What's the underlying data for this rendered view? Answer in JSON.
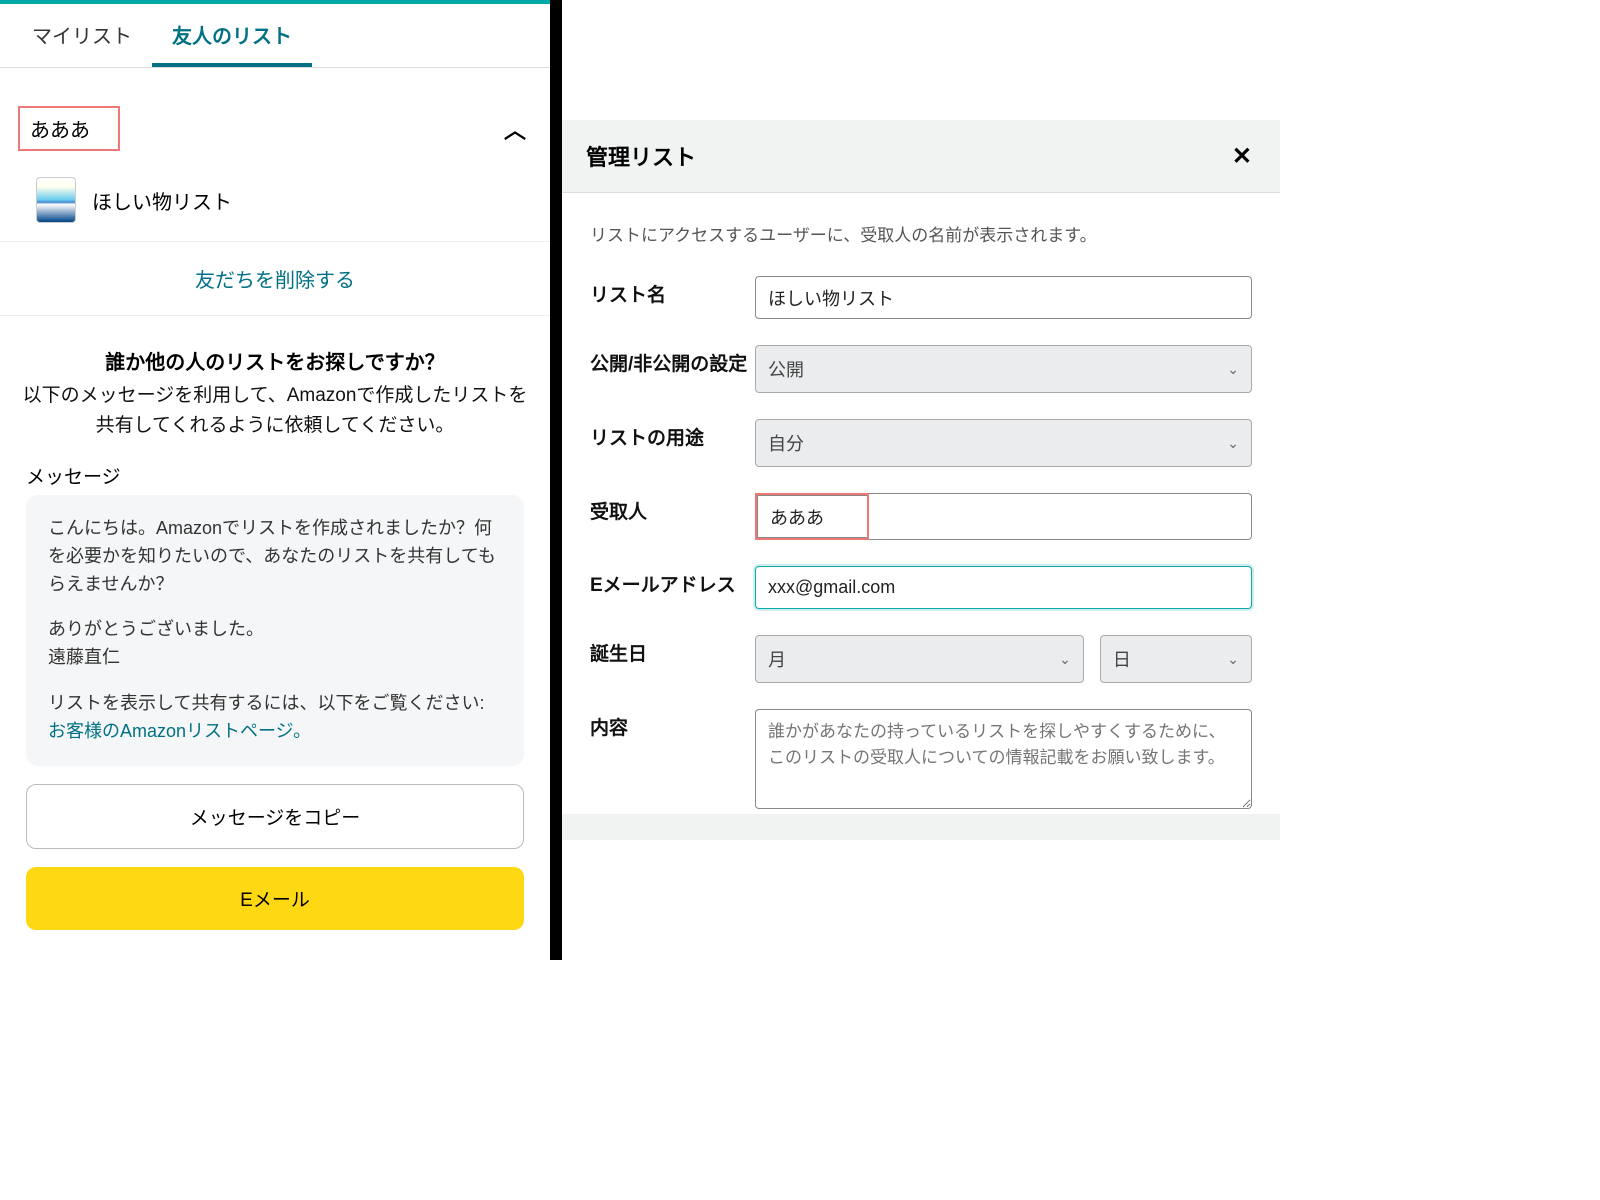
{
  "left": {
    "tabs": {
      "mylist": "マイリスト",
      "friendlist": "友人のリスト"
    },
    "accordion": {
      "title": "あああ"
    },
    "wishlist_item": "ほしい物リスト",
    "delete_friend": "友だちを削除する",
    "looking": {
      "title": "誰か他の人のリストをお探しですか？",
      "desc": "以下のメッセージを利用して、Amazonで作成したリストを共有してくれるように依頼してください。"
    },
    "message_label": "メッセージ",
    "message": {
      "p1": "こんにちは。Amazonでリストを作成されましたか？何を必要かを知りたいので、あなたのリストを共有してもらえませんか？",
      "p2a": "ありがとうございました。",
      "p2b": "遠藤直仁",
      "p3a": "リストを表示して共有するには、以下をご覧ください: ",
      "p3link": "お客様のAmazonリストページ。"
    },
    "copy_btn": "メッセージをコピー",
    "email_btn": "Eメール"
  },
  "right": {
    "modal_title": "管理リスト",
    "subdesc": "リストにアクセスするユーザーに、受取人の名前が表示されます。",
    "labels": {
      "listname": "リスト名",
      "privacy": "公開/非公開の設定",
      "purpose": "リストの用途",
      "recipient": "受取人",
      "email": "Eメールアドレス",
      "birthday": "誕生日",
      "content": "内容"
    },
    "values": {
      "listname": "ほしい物リスト",
      "privacy": "公開",
      "purpose": "自分",
      "recipient": "あああ",
      "email": "xxx@gmail.com",
      "bday_month": "月",
      "bday_day": "日",
      "content_placeholder": "誰かがあなたの持っているリストを探しやすくするために、このリストの受取人についての情報記載をお願い致します。"
    }
  }
}
